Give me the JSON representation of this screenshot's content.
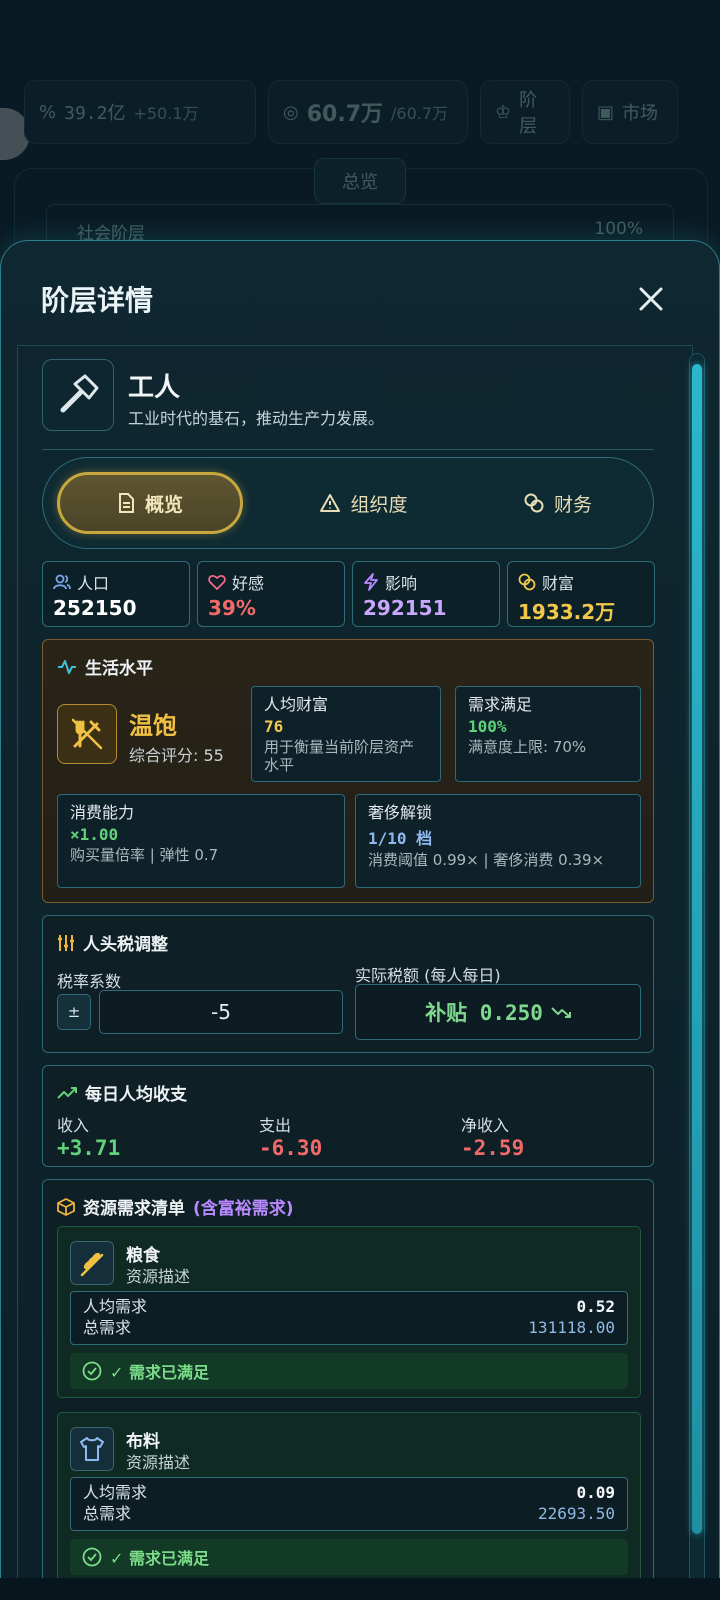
{
  "background": {
    "treasury": "39.2亿",
    "treasury_delta": "+50.1万",
    "population": "60.7万",
    "population_cap": "/60.7万",
    "nav_classes": "阶层",
    "nav_market": "市场",
    "tab_overview": "总览",
    "section_social_class": "社会阶层",
    "section_percent": "100%"
  },
  "modal": {
    "title": "阶层详情",
    "class_name": "工人",
    "class_desc": "工业时代的基石，推动生产力发展。",
    "tabs": [
      {
        "label": "概览",
        "icon": "document-icon",
        "active": true
      },
      {
        "label": "组织度",
        "icon": "warning-icon",
        "active": false
      },
      {
        "label": "财务",
        "icon": "coins-icon",
        "active": false
      }
    ],
    "stats": [
      {
        "label": "人口",
        "value": "252150",
        "color": "#ffffff",
        "icon": "users-icon"
      },
      {
        "label": "好感",
        "value": "39%",
        "color": "#f06a6a",
        "icon": "heart-icon"
      },
      {
        "label": "影响",
        "value": "292151",
        "color": "#c9a7ff",
        "icon": "lightning-icon"
      },
      {
        "label": "财富",
        "value": "1933.2万",
        "color": "#f2c84b",
        "icon": "coins-icon"
      }
    ],
    "living": {
      "title": "生活水平",
      "level": "温饱",
      "score": "综合评分: 55",
      "wealth_title": "人均财富",
      "wealth_value": "76",
      "wealth_desc": "用于衡量当前阶层资产水平",
      "needs_title": "需求满足",
      "needs_value": "100%",
      "needs_desc": "满意度上限: 70%",
      "consume_title": "消费能力",
      "consume_value": "×1.00",
      "consume_desc": "购买量倍率 | 弹性 0.7",
      "luxury_title": "奢侈解锁",
      "luxury_value": "1/10 档",
      "luxury_desc": "消费阈值 0.99× | 奢侈消费 0.39×"
    },
    "tax": {
      "title": "人头税调整",
      "rate_label": "税率系数",
      "pm_label": "±",
      "rate_value": "-5",
      "actual_label": "实际税额 (每人每日)",
      "actual_value": "补贴 0.250"
    },
    "income": {
      "title": "每日人均收支",
      "income_label": "收入",
      "income_value": "+3.71",
      "expense_label": "支出",
      "expense_value": "-6.30",
      "net_label": "净收入",
      "net_value": "-2.59"
    },
    "resources": {
      "title": "资源需求清单",
      "subtitle": "(含富裕需求)",
      "per_capita_label": "人均需求",
      "total_label": "总需求",
      "items": [
        {
          "name": "粮食",
          "desc": "资源描述",
          "per_capita": "0.52",
          "total": "131118.00",
          "status": "✓ 需求已满足"
        },
        {
          "name": "布料",
          "desc": "资源描述",
          "per_capita": "0.09",
          "total": "22693.50",
          "status": "✓ 需求已满足"
        }
      ]
    }
  }
}
